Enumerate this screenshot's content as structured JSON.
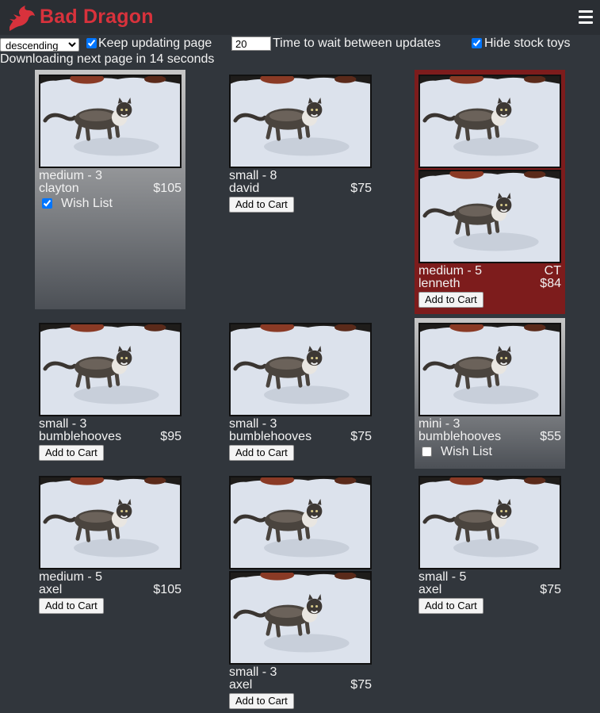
{
  "header": {
    "brand": "Bad Dragon",
    "brand_color": "#d8323c",
    "logo_icon": "dragon-icon",
    "menu_icon": "hamburger-menu-icon"
  },
  "controls": {
    "sort_selected": "descending",
    "keep_updating_label": "Keep updating page",
    "keep_updating_checked": true,
    "wait_value": "20",
    "wait_label": "Time to wait between updates",
    "hide_stock_label": "Hide stock toys",
    "hide_stock_checked": true
  },
  "status": "Downloading next page in 14 seconds",
  "labels": {
    "add_to_cart": "Add to Cart",
    "wish_list": "Wish List"
  },
  "products": [
    {
      "size": "medium - 3",
      "name": "clayton",
      "price": "$105",
      "images": 1,
      "action": "wishlist",
      "wish_checked": true,
      "highlight": "wishlist"
    },
    {
      "size": "small - 8",
      "name": "david",
      "price": "$75",
      "images": 1,
      "action": "cart"
    },
    {
      "size": "medium - 5",
      "name": "lenneth",
      "price": "$84",
      "flag": "CT",
      "images": 2,
      "action": "cart",
      "highlight": "sale"
    },
    {
      "size": "small - 3",
      "name": "bumblehooves",
      "price": "$95",
      "images": 1,
      "action": "cart"
    },
    {
      "size": "small - 3",
      "name": "bumblehooves",
      "price": "$75",
      "images": 1,
      "action": "cart"
    },
    {
      "size": "mini - 3",
      "name": "bumblehooves",
      "price": "$55",
      "images": 1,
      "action": "wishlist",
      "wish_checked": false,
      "highlight": "wishlist"
    },
    {
      "size": "medium - 5",
      "name": "axel",
      "price": "$105",
      "images": 1,
      "action": "cart"
    },
    {
      "size": "small - 3",
      "name": "axel",
      "price": "$75",
      "images": 2,
      "action": "cart"
    },
    {
      "size": "small - 5",
      "name": "axel",
      "price": "$75",
      "images": 1,
      "action": "cart"
    }
  ],
  "colors": {
    "background": "#31363c",
    "header": "#2a2e33",
    "sale_card": "#7d1c1c"
  }
}
